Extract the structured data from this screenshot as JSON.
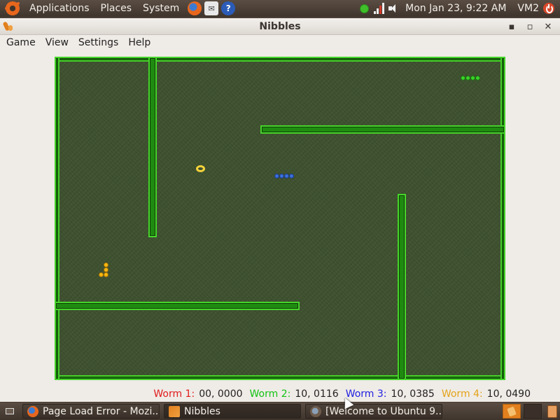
{
  "top_panel": {
    "menus": [
      "Applications",
      "Places",
      "System"
    ],
    "clock": "Mon Jan 23,  9:22 AM",
    "user": "VM2"
  },
  "window": {
    "title": "Nibbles",
    "menu": [
      "Game",
      "View",
      "Settings",
      "Help"
    ]
  },
  "scores": [
    {
      "label": "Worm 1:",
      "value": "00, 0000",
      "color": "#e01b1b"
    },
    {
      "label": "Worm 2:",
      "value": "10, 0116",
      "color": "#12c312"
    },
    {
      "label": "Worm 3:",
      "value": "10, 0385",
      "color": "#1f1fe0"
    },
    {
      "label": "Worm 4:",
      "value": "10, 0490",
      "color": "#e3a31a"
    }
  ],
  "worms": {
    "worm2_color": "#3bd12a",
    "worm3_color": "#3a6fd8",
    "worm4_color": "#f5b80f"
  },
  "taskbar": {
    "tasks": [
      {
        "label": "Page Load Error - Mozi...",
        "icon": "firefox-icon"
      },
      {
        "label": "Nibbles",
        "icon": "nibbles-icon"
      },
      {
        "label": "[Welcome to Ubuntu 9....",
        "icon": "firefox-icon"
      }
    ]
  }
}
